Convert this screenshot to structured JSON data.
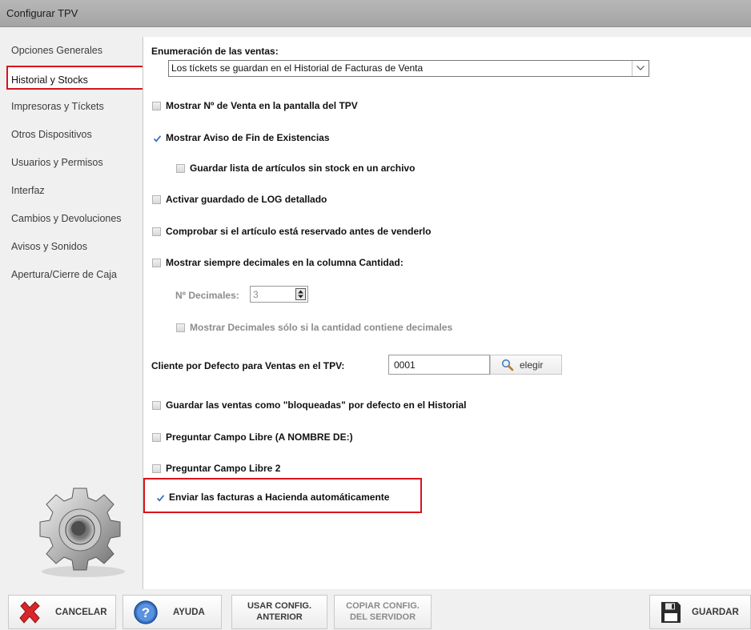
{
  "window": {
    "title": "Configurar TPV"
  },
  "sidebar": {
    "items": [
      {
        "label": "Opciones Generales"
      },
      {
        "label": "Historial y Stocks"
      },
      {
        "label": "Impresoras y Tíckets"
      },
      {
        "label": "Otros Dispositivos"
      },
      {
        "label": "Usuarios y Permisos"
      },
      {
        "label": "Interfaz"
      },
      {
        "label": "Cambios y Devoluciones"
      },
      {
        "label": "Avisos y Sonidos"
      },
      {
        "label": "Apertura/Cierre de Caja"
      }
    ],
    "selected": "Historial y Stocks",
    "gear_icon": "gear-icon"
  },
  "main": {
    "enumeracion_label": "Enumeración de las ventas:",
    "enumeracion_value": "Los tíckets se guardan en el Historial de Facturas de Venta",
    "options": {
      "mostrar_num_venta": {
        "label": "Mostrar Nº de Venta en la pantalla del TPV",
        "checked": false
      },
      "aviso_fin_existencias": {
        "label": "Mostrar Aviso de Fin de Existencias",
        "checked": true
      },
      "guardar_lista_sin_stock": {
        "label": "Guardar lista de artículos sin stock en un archivo",
        "checked": false
      },
      "activar_log": {
        "label": "Activar guardado de LOG detallado",
        "checked": false
      },
      "comprobar_reservado": {
        "label": "Comprobar si el artículo está reservado antes de venderlo",
        "checked": false
      },
      "mostrar_decimales": {
        "label": "Mostrar siempre decimales en la columna Cantidad:",
        "checked": false
      },
      "decimales_solo_si": {
        "label": "Mostrar Decimales sólo si la cantidad contiene decimales",
        "checked": false
      },
      "ventas_bloqueadas": {
        "label": "Guardar las ventas como \"bloqueadas\" por defecto en el Historial",
        "checked": false
      },
      "campo_libre": {
        "label": "Preguntar Campo Libre (A NOMBRE DE:)",
        "checked": false
      },
      "campo_libre_2": {
        "label": "Preguntar Campo Libre 2",
        "checked": false
      },
      "enviar_hacienda": {
        "label": "Enviar las facturas a Hacienda automáticamente",
        "checked": true
      }
    },
    "decimales": {
      "label": "Nº Decimales:",
      "value": "3"
    },
    "cliente": {
      "label": "Cliente por Defecto para Ventas en el TPV:",
      "value": "0001",
      "button": "elegir"
    }
  },
  "footer": {
    "cancelar": "CANCELAR",
    "ayuda": "AYUDA",
    "usar_config_1": "USAR CONFIG.",
    "usar_config_2": "ANTERIOR",
    "copiar_config_1": "COPIAR CONFIG.",
    "copiar_config_2": "DEL SERVIDOR",
    "guardar": "GUARDAR"
  },
  "colors": {
    "highlight": "#d9141c",
    "check": "#3b6fc4"
  }
}
